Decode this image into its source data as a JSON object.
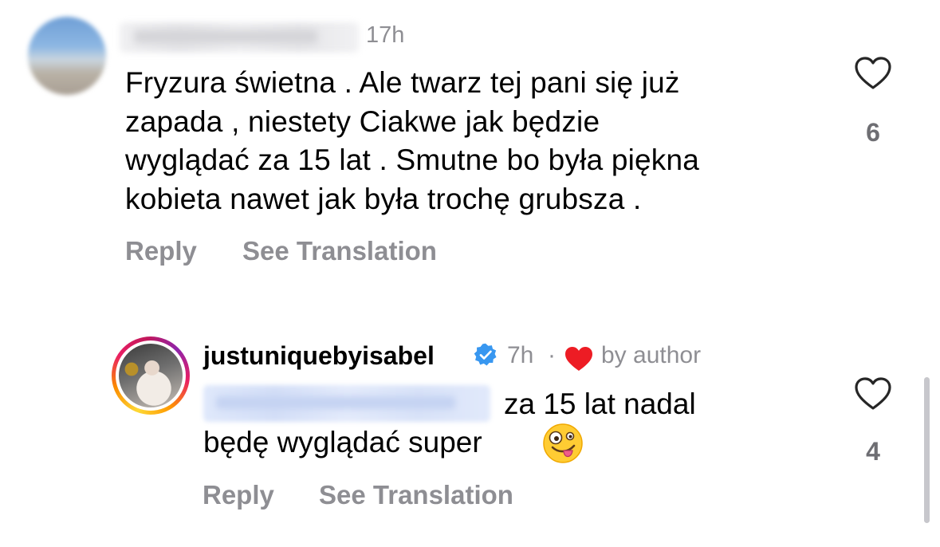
{
  "comments": [
    {
      "username": "pompeii_yellowtoe",
      "time": "17h",
      "text_lines": [
        "Fryzura świetna . Ale twarz tej pani się już",
        "zapada , niestety Ciakwe jak będzie",
        "wyglądać za 15 lat . Smutne bo była piękna",
        "kobieta nawet jak była trochę  grubsza ."
      ],
      "reply_label": "Reply",
      "translate_label": "See Translation",
      "like_count": "6",
      "like_icon": "heart-outline-icon"
    },
    {
      "username": "justuniquebyisabel",
      "verified": true,
      "time": "7h",
      "separator": "·",
      "author_badge": "by author",
      "mention": "@pompeii_yellowtoe",
      "text_part1": "za 15 lat nadal",
      "text_part2": "będę wyglądać super",
      "emoji": "zany-face-emoji",
      "reply_label": "Reply",
      "translate_label": "See Translation",
      "like_count": "4",
      "like_icon": "heart-outline-icon"
    }
  ],
  "colors": {
    "secondary_text": "#8e8e93",
    "verified_blue": "#3897f0",
    "author_heart": "#ed1c24"
  }
}
